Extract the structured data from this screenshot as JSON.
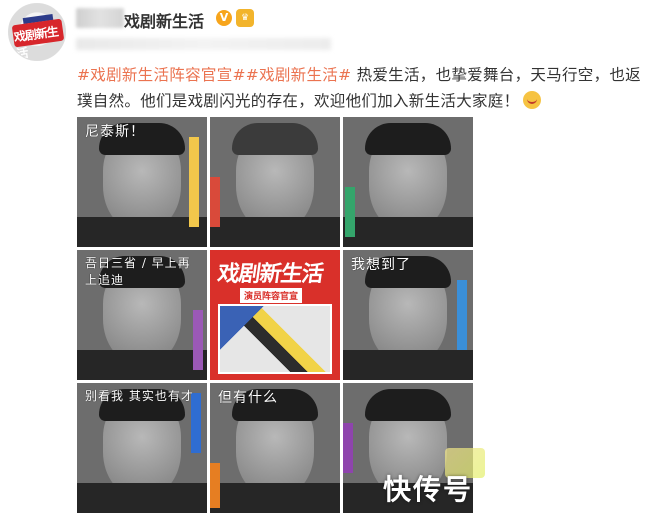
{
  "account": {
    "username": "戏剧新生活",
    "verified_icon": "verified-v-icon",
    "badge_icon": "member-badge-icon"
  },
  "avatar": {
    "logo_text": "戏剧新生活"
  },
  "post": {
    "tag1": "#戏剧新生活阵容官宣#",
    "tag2": "#戏剧新生活#",
    "body": " 热爱生活，也挚爱舞台，天马行空，也返璞自然。他们是戏剧闪光的存在，欢迎他们加入新生活大家庭！"
  },
  "grid": {
    "cells": [
      {
        "scribble": "尼泰斯！",
        "stripe": "#f2c74b"
      },
      {
        "scribble": "",
        "stripe": "#d94a3a"
      },
      {
        "scribble": "",
        "stripe": "#34a56b"
      },
      {
        "scribble": "吾日三省 / 早上再 上追迪",
        "stripe": "#9b59b6"
      },
      {
        "title": "戏剧新生活",
        "subtitle": "演员阵容官宣",
        "stripe": "#d9302a"
      },
      {
        "scribble": "我想到了",
        "stripe": "#3a8fd9"
      },
      {
        "scribble": "别看我 其实也有才",
        "stripe": "#2f6dd1"
      },
      {
        "scribble": "但有什么",
        "stripe": "#e67e22"
      },
      {
        "scribble": "",
        "stripe": "#8e44ad"
      }
    ]
  },
  "watermark": {
    "text": "快传号"
  },
  "colors": {
    "tag": "#eb7350",
    "text": "#333333",
    "poster_red": "#d9302a"
  }
}
